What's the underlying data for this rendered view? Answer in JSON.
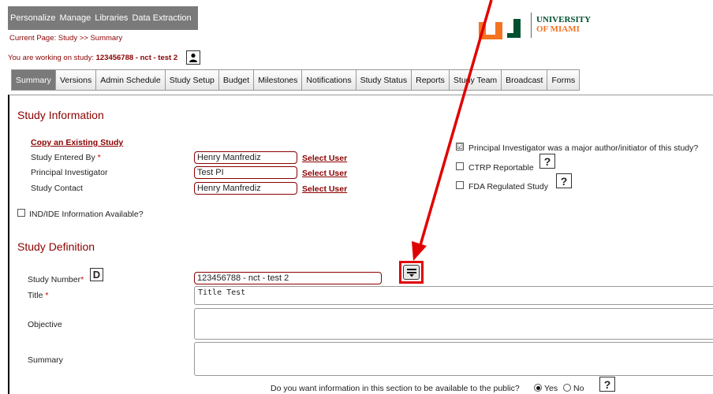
{
  "nav": {
    "items": [
      "Personalize",
      "Manage",
      "Libraries",
      "Data Extraction"
    ]
  },
  "breadcrumb": "Current Page: Study >> Summary",
  "working": {
    "prefix": "You are working on study:",
    "study": "123456788 - nct - test 2"
  },
  "logo": {
    "line1": "UNIVERSITY",
    "line2": "OF MIAMI"
  },
  "tabs": [
    "Summary",
    "Versions",
    "Admin Schedule",
    "Study Setup",
    "Budget",
    "Milestones",
    "Notifications",
    "Study Status",
    "Reports",
    "Study Team",
    "Broadcast",
    "Forms"
  ],
  "study_info": {
    "heading": "Study Information",
    "copy_link": "Copy an Existing Study",
    "entered_by_label": "Study Entered By",
    "entered_by_value": "Henry Manfrediz",
    "pi_label": "Principal Investigator",
    "pi_value": "Test PI",
    "contact_label": "Study Contact",
    "contact_value": "Henry Manfrediz",
    "select_user": "Select User",
    "ind_ide": "IND/IDE Information Available?",
    "pi_major": "Principal Investigator was a major author/initiator of this study?",
    "ctrp": "CTRP Reportable",
    "fda": "FDA Regulated Study"
  },
  "study_def": {
    "heading": "Study Definition",
    "number_label": "Study Number",
    "number_value": "123456788 - nct - test 2",
    "title_label": "Title",
    "title_value": "Title Test",
    "objective_label": "Objective",
    "summary_label": "Summary",
    "public_question": "Do you want information in this section to be available to the public?",
    "yes": "Yes",
    "no": "No"
  },
  "req_mark": "*",
  "d_badge": "D",
  "help_mark": "?",
  "check_mark": "☑",
  "colors": {
    "accent": "#8b0000",
    "highlight": "#e00000",
    "nav_bg": "#7a7a7a"
  }
}
